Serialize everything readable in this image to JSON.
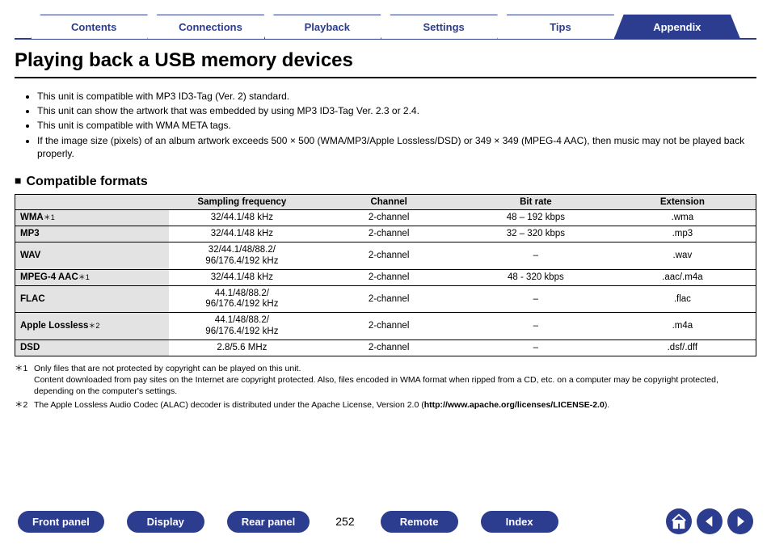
{
  "tabs": [
    {
      "label": "Contents",
      "active": false
    },
    {
      "label": "Connections",
      "active": false
    },
    {
      "label": "Playback",
      "active": false
    },
    {
      "label": "Settings",
      "active": false
    },
    {
      "label": "Tips",
      "active": false
    },
    {
      "label": "Appendix",
      "active": true
    }
  ],
  "title": "Playing back a USB memory devices",
  "bullets": [
    "This unit is compatible with MP3 ID3-Tag (Ver. 2) standard.",
    "This unit can show the artwork that was embedded by using MP3 ID3-Tag Ver. 2.3 or 2.4.",
    "This unit is compatible with WMA META tags.",
    "If the image size (pixels) of an album artwork exceeds 500 × 500 (WMA/MP3/Apple Lossless/DSD) or 349 × 349 (MPEG-4 AAC), then music may not be played back properly."
  ],
  "section_title": "Compatible formats",
  "table": {
    "headers": [
      "",
      "Sampling frequency",
      "Channel",
      "Bit rate",
      "Extension"
    ],
    "rows": [
      {
        "name": "WMA",
        "note": "＊1",
        "cells": [
          "32/44.1/48 kHz",
          "2-channel",
          "48 – 192 kbps",
          ".wma"
        ]
      },
      {
        "name": "MP3",
        "note": "",
        "cells": [
          "32/44.1/48 kHz",
          "2-channel",
          "32 – 320 kbps",
          ".mp3"
        ]
      },
      {
        "name": "WAV",
        "note": "",
        "cells": [
          "32/44.1/48/88.2/\n96/176.4/192 kHz",
          "2-channel",
          "–",
          ".wav"
        ]
      },
      {
        "name": "MPEG-4 AAC",
        "note": "＊1",
        "cells": [
          "32/44.1/48 kHz",
          "2-channel",
          "48 - 320 kbps",
          ".aac/.m4a"
        ]
      },
      {
        "name": "FLAC",
        "note": "",
        "cells": [
          "44.1/48/88.2/\n96/176.4/192 kHz",
          "2-channel",
          "–",
          ".flac"
        ]
      },
      {
        "name": "Apple Lossless",
        "note": "＊2",
        "cells": [
          "44.1/48/88.2/\n96/176.4/192 kHz",
          "2-channel",
          "–",
          ".m4a"
        ]
      },
      {
        "name": "DSD",
        "note": "",
        "cells": [
          "2.8/5.6 MHz",
          "2-channel",
          "–",
          ".dsf/.dff"
        ]
      }
    ]
  },
  "footnotes": [
    {
      "mark": "＊1",
      "text": "Only files that are not protected by copyright can be played on this unit.\nContent downloaded from pay sites on the Internet are copyright protected. Also, files encoded in WMA format when ripped from a CD, etc. on a computer may be copyright protected, depending on the computer's settings."
    },
    {
      "mark": "＊2",
      "text_pre": "The Apple Lossless Audio Codec (ALAC) decoder is distributed under the Apache License, Version 2.0 (",
      "text_bold": "http://www.apache.org/licenses/LICENSE-2.0",
      "text_post": ")."
    }
  ],
  "bottom": {
    "buttons": [
      "Front panel",
      "Display",
      "Rear panel"
    ],
    "page_number": "252",
    "buttons_after": [
      "Remote",
      "Index"
    ]
  }
}
